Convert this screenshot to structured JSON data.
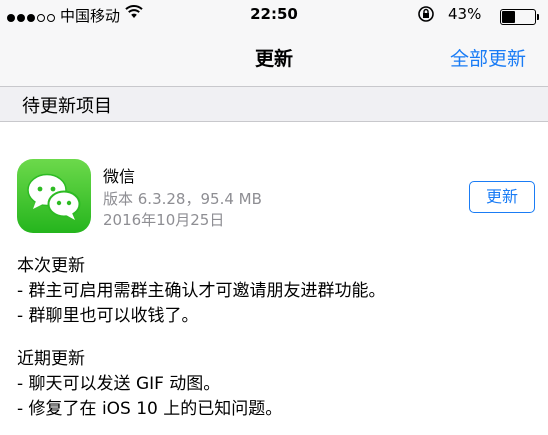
{
  "status_bar": {
    "carrier": "中国移动",
    "time": "22:50",
    "battery_percent": "43%",
    "battery_level": 0.43,
    "signal_bars_filled": 3,
    "signal_bars_total": 5
  },
  "nav": {
    "title": "更新",
    "action_label": "全部更新"
  },
  "section": {
    "title": "待更新项目"
  },
  "app": {
    "name": "微信",
    "version_line": "版本 6.3.28，95.4 MB",
    "date": "2016年10月25日",
    "update_label": "更新",
    "icon": "wechat-icon"
  },
  "release_notes": {
    "current_header": "本次更新",
    "current_items": [
      "- 群主可启用需群主确认才可邀请朋友进群功能。",
      "- 群聊里也可以收钱了。"
    ],
    "recent_header": "近期更新",
    "recent_items": [
      "- 聊天可以发送 GIF 动图。",
      "- 修复了在 iOS 10 上的已知问题。"
    ]
  },
  "colors": {
    "accent": "#1a7cf5",
    "icon_green": "#2dbb23"
  }
}
